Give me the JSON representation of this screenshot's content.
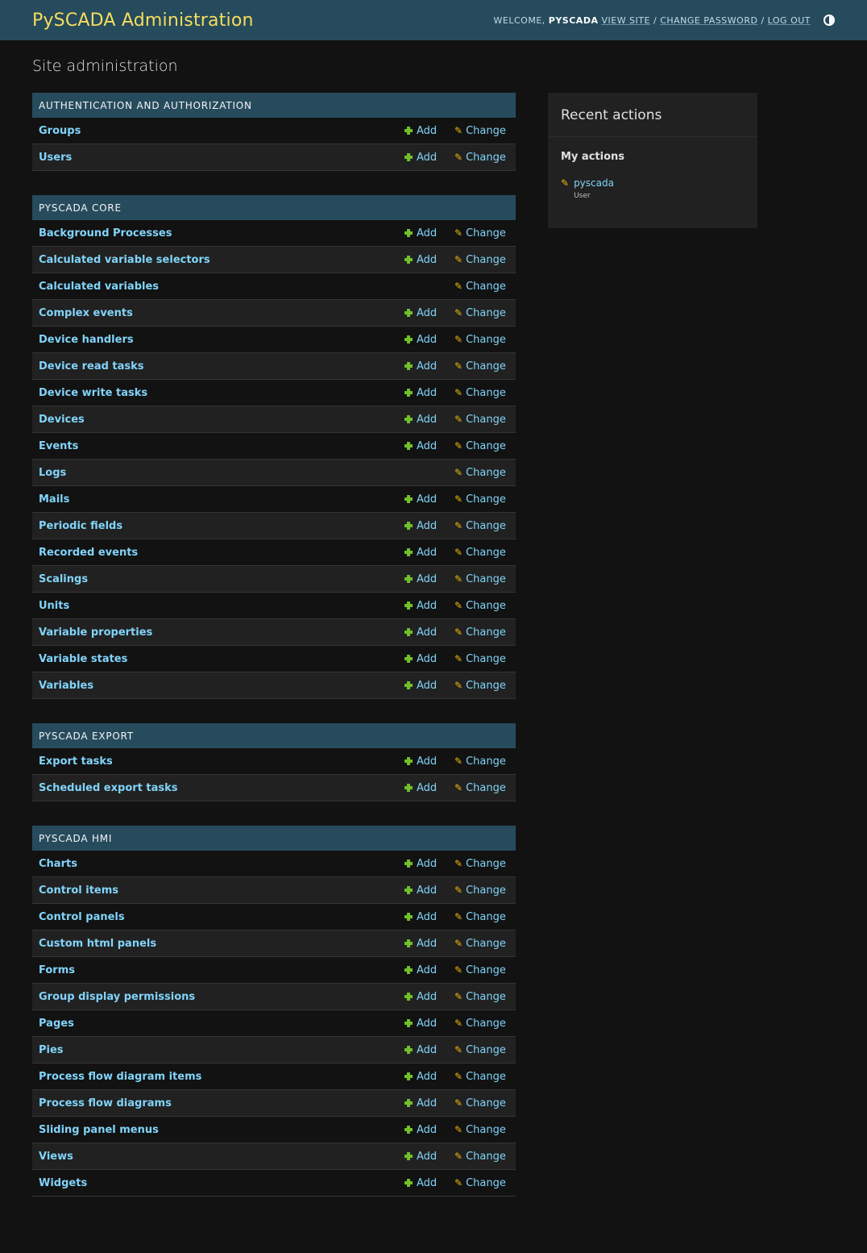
{
  "header": {
    "branding": "PySCADA Administration",
    "welcome": "WELCOME,",
    "username": "PYSCADA",
    "view_site": "VIEW SITE",
    "change_password": "CHANGE PASSWORD",
    "log_out": "LOG OUT",
    "separator": "/"
  },
  "page_title": "Site administration",
  "labels": {
    "add": "Add",
    "change": "Change"
  },
  "modules": [
    {
      "title": "AUTHENTICATION AND AUTHORIZATION",
      "rows": [
        {
          "name": "Groups",
          "add": true
        },
        {
          "name": "Users",
          "add": true
        }
      ]
    },
    {
      "title": "PYSCADA CORE",
      "rows": [
        {
          "name": "Background Processes",
          "add": true
        },
        {
          "name": "Calculated variable selectors",
          "add": true
        },
        {
          "name": "Calculated variables",
          "add": false
        },
        {
          "name": "Complex events",
          "add": true
        },
        {
          "name": "Device handlers",
          "add": true
        },
        {
          "name": "Device read tasks",
          "add": true
        },
        {
          "name": "Device write tasks",
          "add": true
        },
        {
          "name": "Devices",
          "add": true
        },
        {
          "name": "Events",
          "add": true
        },
        {
          "name": "Logs",
          "add": false
        },
        {
          "name": "Mails",
          "add": true
        },
        {
          "name": "Periodic fields",
          "add": true
        },
        {
          "name": "Recorded events",
          "add": true
        },
        {
          "name": "Scalings",
          "add": true
        },
        {
          "name": "Units",
          "add": true
        },
        {
          "name": "Variable properties",
          "add": true
        },
        {
          "name": "Variable states",
          "add": true
        },
        {
          "name": "Variables",
          "add": true
        }
      ]
    },
    {
      "title": "PYSCADA EXPORT",
      "rows": [
        {
          "name": "Export tasks",
          "add": true
        },
        {
          "name": "Scheduled export tasks",
          "add": true
        }
      ]
    },
    {
      "title": "PYSCADA HMI",
      "rows": [
        {
          "name": "Charts",
          "add": true
        },
        {
          "name": "Control items",
          "add": true
        },
        {
          "name": "Control panels",
          "add": true
        },
        {
          "name": "Custom html panels",
          "add": true
        },
        {
          "name": "Forms",
          "add": true
        },
        {
          "name": "Group display permissions",
          "add": true
        },
        {
          "name": "Pages",
          "add": true
        },
        {
          "name": "Pies",
          "add": true
        },
        {
          "name": "Process flow diagram items",
          "add": true
        },
        {
          "name": "Process flow diagrams",
          "add": true
        },
        {
          "name": "Sliding panel menus",
          "add": true
        },
        {
          "name": "Views",
          "add": true
        },
        {
          "name": "Widgets",
          "add": true
        }
      ]
    }
  ],
  "recent_actions": {
    "title": "Recent actions",
    "subtitle": "My actions",
    "entries": [
      {
        "label": "pyscada",
        "type": "User"
      }
    ]
  },
  "colors": {
    "header_bg": "#264b5d",
    "brand": "#f5dd5d",
    "link": "#81d4fa",
    "add_icon": "#70bf2b",
    "change_icon": "#efb80b"
  }
}
